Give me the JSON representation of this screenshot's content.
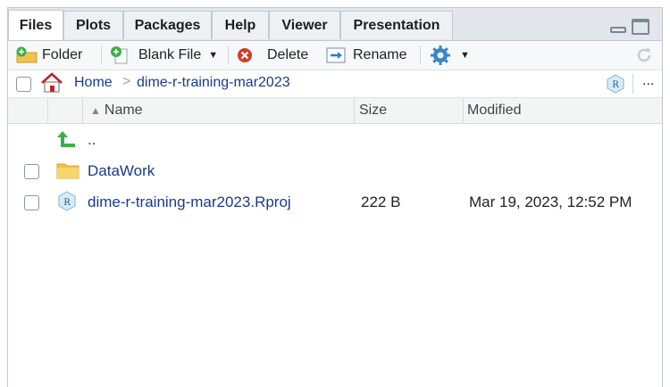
{
  "tabs": [
    {
      "label": "Files",
      "active": true
    },
    {
      "label": "Plots",
      "active": false
    },
    {
      "label": "Packages",
      "active": false
    },
    {
      "label": "Help",
      "active": false
    },
    {
      "label": "Viewer",
      "active": false
    },
    {
      "label": "Presentation",
      "active": false
    }
  ],
  "toolbar": {
    "new_folder_label": "Folder",
    "new_blank_file_label": "Blank File",
    "delete_label": "Delete",
    "rename_label": "Rename"
  },
  "breadcrumb": {
    "home_label": "Home",
    "separator": ">",
    "current": "dime-r-training-mar2023",
    "more_label": "..."
  },
  "table": {
    "columns": {
      "name": "Name",
      "size": "Size",
      "modified": "Modified"
    },
    "parent_label": "..",
    "rows": [
      {
        "name": "DataWork",
        "type": "folder",
        "size": "",
        "modified": ""
      },
      {
        "name": "dime-r-training-mar2023.Rproj",
        "type": "rproj",
        "size": "222 B",
        "modified": "Mar 19, 2023, 12:52 PM"
      }
    ]
  },
  "colors": {
    "link": "#1a3a8c",
    "tab_strip": "#e3e7eb",
    "folder": "#f2c24f",
    "up_arrow": "#3cae4a",
    "delete": "#d23c2a"
  }
}
